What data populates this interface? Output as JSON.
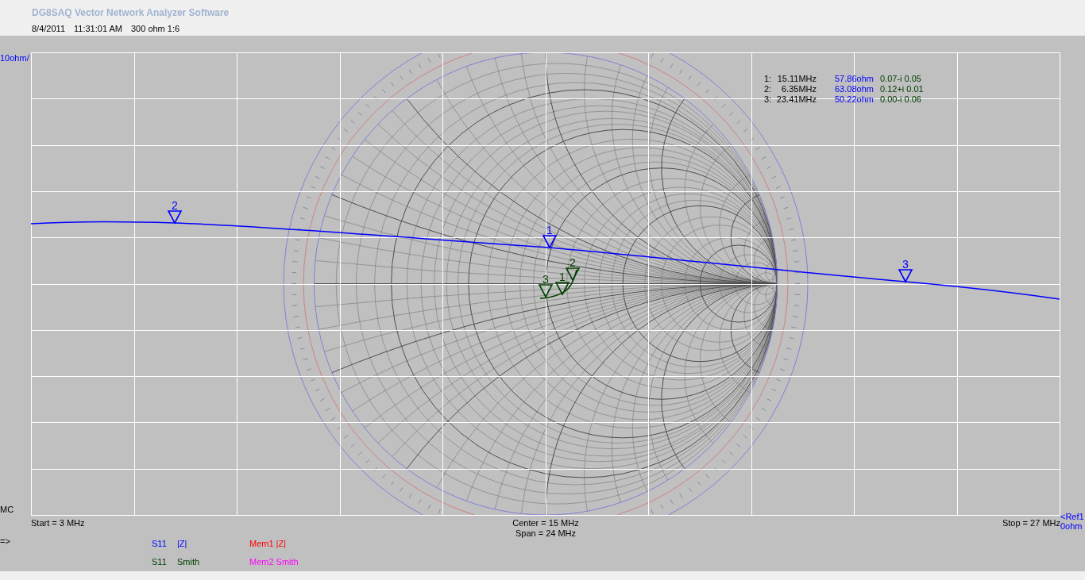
{
  "app": {
    "title": "DG8SAQ Vector Network Analyzer Software",
    "info": {
      "date": "8/4/2011",
      "time": "11:31:01 AM",
      "setup": "300 ohm 1:6"
    }
  },
  "plot": {
    "scale_label": "10ohm/",
    "mode_label": "MC",
    "traces": [
      {
        "kind": "magnitude",
        "color": "#0000ff",
        "markers": [
          {
            "label": "1"
          },
          {
            "label": "2"
          },
          {
            "label": "3"
          }
        ]
      },
      {
        "kind": "smith",
        "color": "#004000",
        "markers": [
          {
            "label": "1"
          },
          {
            "label": "2"
          },
          {
            "label": "3"
          }
        ]
      }
    ],
    "marker_readout": [
      {
        "index": "1:",
        "frequency": "15.11MHz",
        "impedance": "57.86ohm",
        "reflection": "0.07-i 0.05"
      },
      {
        "index": "2:",
        "frequency": "6.35MHz",
        "impedance": "63.08ohm",
        "reflection": "0.12+i 0.01"
      },
      {
        "index": "3:",
        "frequency": "23.41MHz",
        "impedance": "50.22ohm",
        "reflection": "0.00-i 0.06"
      }
    ]
  },
  "axis": {
    "start": "Start = 3 MHz",
    "center": "Center = 15 MHz",
    "span": "Span = 24 MHz",
    "stop": "Stop = 27 MHz",
    "reference": {
      "marker": "<Ref1",
      "value": "0ohm"
    }
  },
  "prompt": "=>",
  "legend": [
    {
      "kind": "measured",
      "source": "S11",
      "trace": "|Z|",
      "color": "#0000ff"
    },
    {
      "kind": "memory",
      "label": "Mem1 |Z|",
      "color": "#ff0000"
    },
    {
      "kind": "measured",
      "source": "S11",
      "trace": "Smith",
      "color": "#004000"
    },
    {
      "kind": "memory",
      "label": "Mem2 Smith",
      "color": "#ff00ff"
    }
  ]
}
